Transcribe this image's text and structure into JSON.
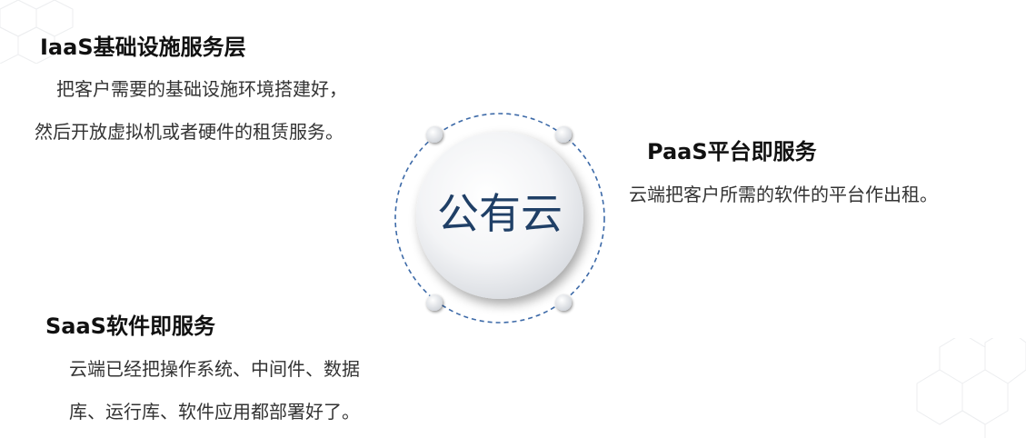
{
  "center": {
    "label": "公有云"
  },
  "iaas": {
    "title": "IaaS基础设施服务层",
    "lines": [
      "把客户需要的基础设施环境搭建好，",
      "然后开放虚拟机或者硬件的租赁服务。"
    ]
  },
  "paas": {
    "title": "PaaS平台即服务",
    "lines": [
      "云端把客户所需的软件的平台作出租。"
    ]
  },
  "saas": {
    "title": "SaaS软件即服务",
    "lines": [
      "云端已经把操作系统、中间件、数据",
      "库、运行库、软件应用都部署好了。"
    ]
  },
  "colors": {
    "dashed_ring": "#3d6aa8",
    "center_text": "#1f3f66",
    "title_text": "#111111",
    "body_text": "#333333"
  }
}
